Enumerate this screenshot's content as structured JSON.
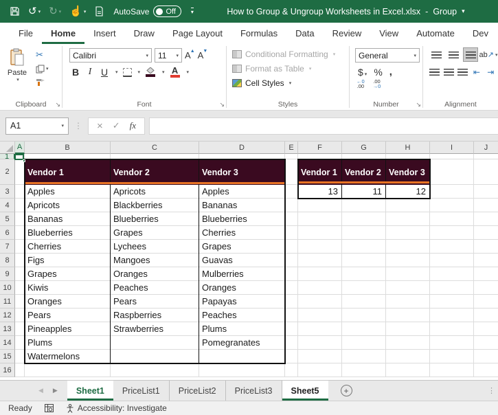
{
  "colors": {
    "excel_green": "#1E6C43",
    "table_header_fill": "#3A0A20",
    "table_header_accent": "#E87425",
    "font_color_swatch": "#E03C31",
    "fill_color_swatch": "#3A0A20"
  },
  "title_bar": {
    "autosave_label": "AutoSave",
    "autosave_state": "Off",
    "document_title": "How to Group & Ungroup Worksheets in Excel.xlsx",
    "title_separator": "-",
    "group_indicator": "Group"
  },
  "ribbon_tabs": {
    "file": "File",
    "home": "Home",
    "insert": "Insert",
    "draw": "Draw",
    "page_layout": "Page Layout",
    "formulas": "Formulas",
    "data": "Data",
    "review": "Review",
    "view": "View",
    "automate": "Automate",
    "dev": "Dev"
  },
  "ribbon": {
    "clipboard": {
      "group_label": "Clipboard",
      "paste_label": "Paste"
    },
    "font": {
      "group_label": "Font",
      "font_name": "Calibri",
      "font_size": "11",
      "bold": "B",
      "italic": "I",
      "underline": "U",
      "grow": "A",
      "shrink": "A",
      "orientation_ab": "ab"
    },
    "styles": {
      "group_label": "Styles",
      "conditional_formatting": "Conditional Formatting",
      "format_as_table": "Format as Table",
      "cell_styles": "Cell Styles"
    },
    "number": {
      "group_label": "Number",
      "format": "General",
      "currency": "$",
      "percent": "%",
      "comma": ",",
      "inc_decimal_top": "←0",
      "inc_decimal_bottom": ".00",
      "dec_decimal_top": ".00",
      "dec_decimal_bottom": "→0"
    },
    "alignment": {
      "group_label": "Alignment"
    }
  },
  "formula_bar": {
    "name_box": "A1",
    "cancel": "×",
    "enter": "✓",
    "fx": "fx"
  },
  "grid": {
    "columns": [
      "A",
      "B",
      "C",
      "D",
      "E",
      "F",
      "G",
      "H",
      "I",
      "J"
    ],
    "active_cell": "A1"
  },
  "rows": [
    {
      "n": "1"
    },
    {
      "n": "2",
      "b": "Vendor 1",
      "c": "Vendor 2",
      "d": "Vendor 3",
      "f": "Vendor 1",
      "g": "Vendor 2",
      "h": "Vendor 3"
    },
    {
      "n": "3",
      "b": "Apples",
      "c": "Apricots",
      "d": "Apples",
      "f": "13",
      "g": "11",
      "h": "12"
    },
    {
      "n": "4",
      "b": "Apricots",
      "c": "Blackberries",
      "d": "Bananas"
    },
    {
      "n": "5",
      "b": "Bananas",
      "c": "Blueberries",
      "d": "Blueberries"
    },
    {
      "n": "6",
      "b": "Blueberries",
      "c": "Grapes",
      "d": "Cherries"
    },
    {
      "n": "7",
      "b": "Cherries",
      "c": "Lychees",
      "d": "Grapes"
    },
    {
      "n": "8",
      "b": "Figs",
      "c": "Mangoes",
      "d": "Guavas"
    },
    {
      "n": "9",
      "b": "Grapes",
      "c": "Oranges",
      "d": "Mulberries"
    },
    {
      "n": "10",
      "b": "Kiwis",
      "c": "Peaches",
      "d": "Oranges"
    },
    {
      "n": "11",
      "b": "Oranges",
      "c": "Pears",
      "d": "Papayas"
    },
    {
      "n": "12",
      "b": "Pears",
      "c": "Raspberries",
      "d": "Peaches"
    },
    {
      "n": "13",
      "b": "Pineapples",
      "c": "Strawberries",
      "d": "Plums"
    },
    {
      "n": "14",
      "b": "Plums",
      "c": "",
      "d": "Pomegranates"
    },
    {
      "n": "15",
      "b": "Watermelons",
      "c": "",
      "d": ""
    },
    {
      "n": "16"
    }
  ],
  "sheet_tabs": {
    "tabs": [
      {
        "label": "Sheet1",
        "state": "active"
      },
      {
        "label": "PriceList1",
        "state": "normal"
      },
      {
        "label": "PriceList2",
        "state": "normal"
      },
      {
        "label": "PriceList3",
        "state": "normal"
      },
      {
        "label": "Sheet5",
        "state": "selected"
      }
    ],
    "add_label": "+"
  },
  "status_bar": {
    "mode": "Ready",
    "accessibility": "Accessibility: Investigate"
  }
}
